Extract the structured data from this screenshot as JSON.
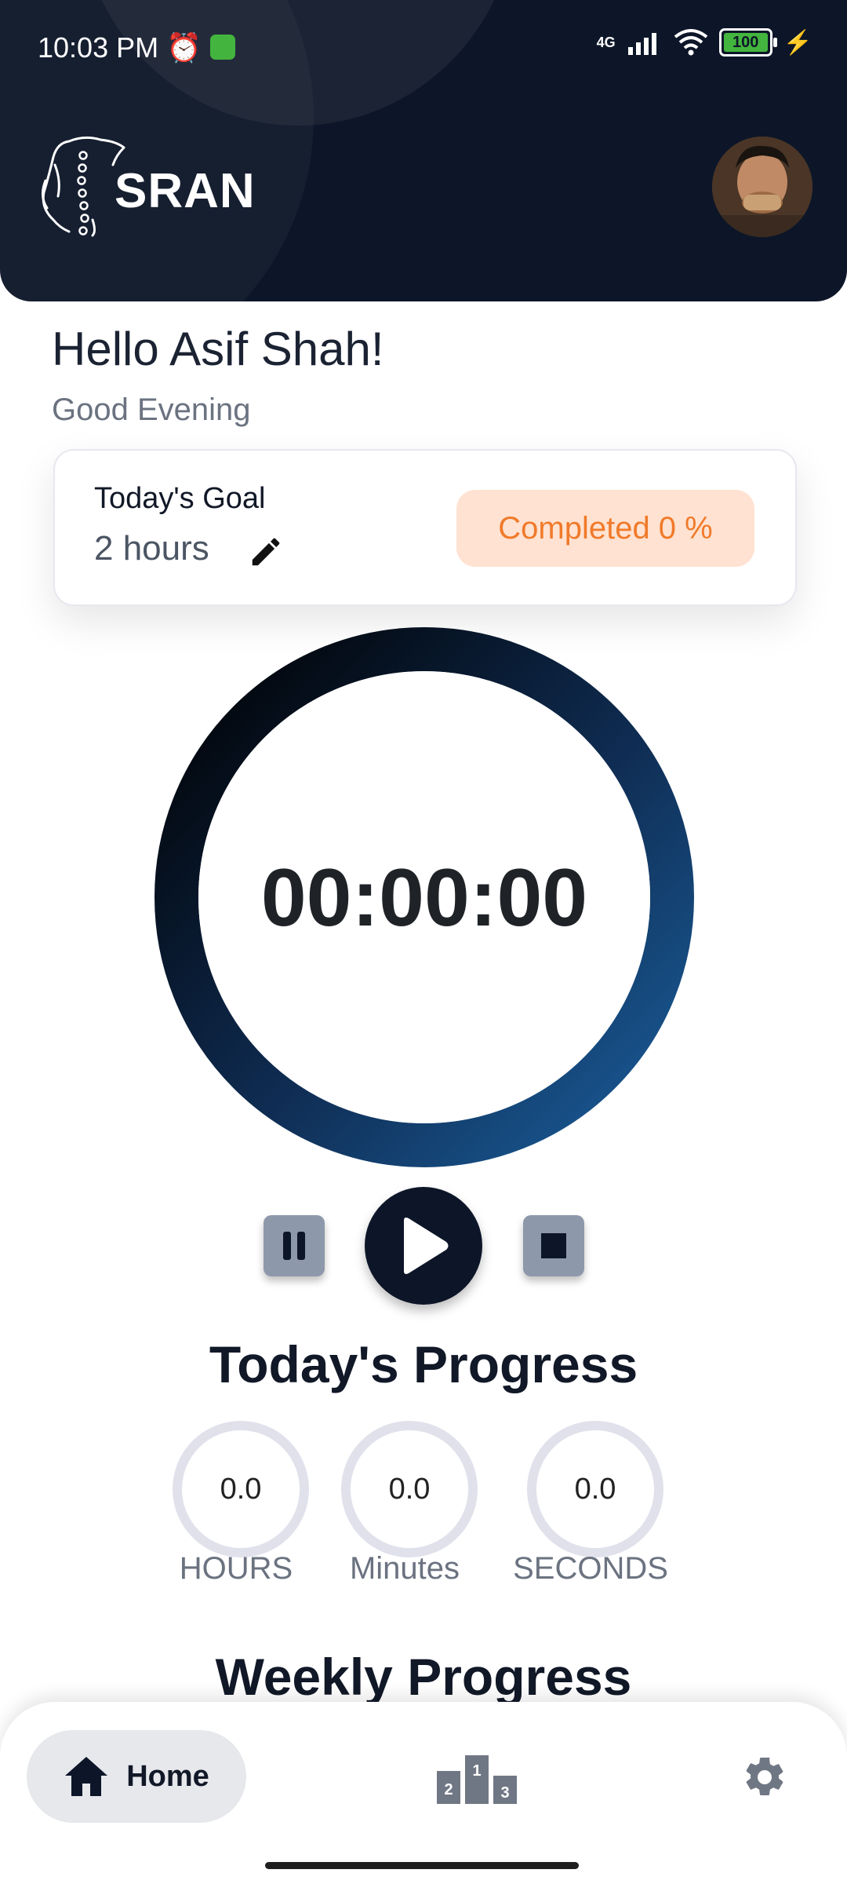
{
  "status_bar": {
    "time": "10:03 PM",
    "network": "4G",
    "battery": "100"
  },
  "app": {
    "logo_text": "SRAN"
  },
  "greeting": {
    "hello": "Hello Asif Shah!",
    "sub": "Good Evening"
  },
  "goal": {
    "title": "Today's Goal",
    "value": "2 hours",
    "completed": "Completed 0 %"
  },
  "timer": {
    "display": "00:00:00"
  },
  "progress": {
    "title": "Today's Progress",
    "items": [
      {
        "value": "0.0",
        "label": "HOURS"
      },
      {
        "value": "0.0",
        "label": "Minutes"
      },
      {
        "value": "0.0",
        "label": "SECONDS"
      }
    ]
  },
  "weekly": {
    "title": "Weekly Progress"
  },
  "nav": {
    "home": "Home"
  },
  "colors": {
    "header_bg": "#0d1628",
    "accent_orange": "#f07a2a",
    "completed_bg": "#ffe2d1",
    "ring_gradient_start": "#1a5d9a",
    "ring_gradient_end": "#000000"
  }
}
